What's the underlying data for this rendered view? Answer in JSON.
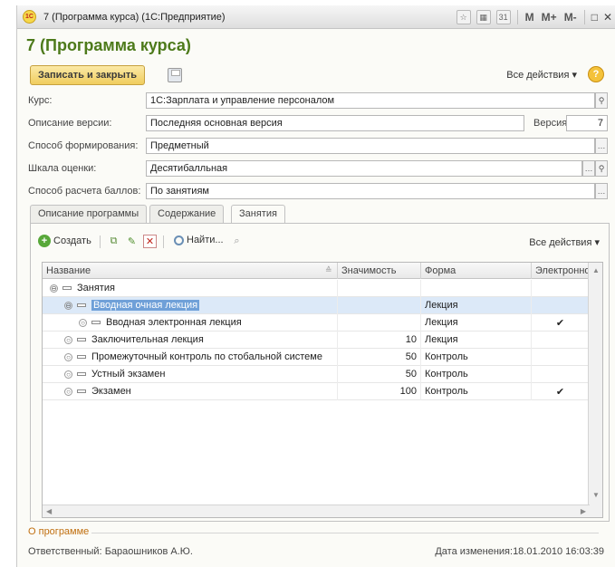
{
  "window": {
    "title": "7 (Программа курса)  (1С:Предприятие)",
    "logo_text": "1С",
    "memory_buttons": [
      "M",
      "M+",
      "M-"
    ]
  },
  "form": {
    "title": "7 (Программа курса)",
    "save_close_label": "Записать и закрыть",
    "all_actions_label": "Все действия ▾",
    "help_label": "?"
  },
  "fields": {
    "course_label": "Курс:",
    "course_value": "1С:Зарплата и управление персоналом",
    "version_desc_label": "Описание версии:",
    "version_desc_value": "Последняя основная версия",
    "version_label": "Версия:",
    "version_value": "7",
    "method_label": "Способ формирования:",
    "method_value": "Предметный",
    "scale_label": "Шкала оценки:",
    "scale_value": "Десятибалльная",
    "score_calc_label": "Способ расчета баллов:",
    "score_calc_value": "По занятиям"
  },
  "tabs": [
    "Описание программы",
    "Содержание",
    "Занятия"
  ],
  "tab_toolbar": {
    "create_label": "Создать",
    "find_label": "Найти...",
    "all_actions_label": "Все действия ▾"
  },
  "table": {
    "columns": [
      "Название",
      "Значимость",
      "Форма",
      "Электронное"
    ],
    "rows": [
      {
        "name": "Занятия",
        "weight": "",
        "form": "",
        "electronic": "",
        "level": 0,
        "toggle": "⊖"
      },
      {
        "name": "Вводная очная лекция",
        "weight": "",
        "form": "Лекция",
        "electronic": "",
        "level": 1,
        "toggle": "⊖"
      },
      {
        "name": "Вводная электронная лекция",
        "weight": "",
        "form": "Лекция",
        "electronic": "✔",
        "level": 2,
        "toggle": "○"
      },
      {
        "name": "Заключительная лекция",
        "weight": "10",
        "form": "Лекция",
        "electronic": "",
        "level": 1,
        "toggle": "○"
      },
      {
        "name": "Промежуточный контроль по стобальной системе",
        "weight": "50",
        "form": "Контроль",
        "electronic": "",
        "level": 1,
        "toggle": "○"
      },
      {
        "name": "Устный экзамен",
        "weight": "50",
        "form": "Контроль",
        "electronic": "",
        "level": 1,
        "toggle": "○"
      },
      {
        "name": "Экзамен",
        "weight": "100",
        "form": "Контроль",
        "electronic": "✔",
        "level": 1,
        "toggle": "○"
      }
    ]
  },
  "footer": {
    "about_label": "О программе",
    "responsible_label": "Ответственный:",
    "responsible_value": "Барaошников А.Ю.",
    "changed_label": "Дата изменения:",
    "changed_value": "18.01.2010 16:03:39"
  }
}
